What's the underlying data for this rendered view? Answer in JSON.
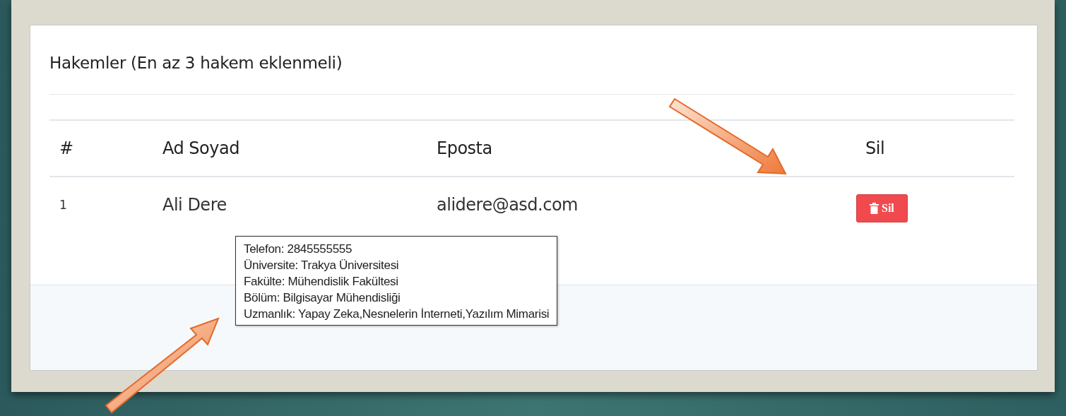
{
  "panel": {
    "title": "Hakemler (En az 3 hakem eklenmeli)"
  },
  "table": {
    "columns": [
      "#",
      "Ad Soyad",
      "Eposta",
      "Sil"
    ],
    "rows": [
      {
        "index": "1",
        "name": "Ali Dere",
        "email": "alidere@asd.com",
        "delete_button": "Sil"
      }
    ]
  },
  "tooltip": {
    "lines": [
      "Telefon: 2845555555",
      "Üniversite: Trakya Üniversitesi",
      "Fakülte: Mühendislik Fakültesi",
      "Bölüm: Bilgisayar Mühendisliği",
      "Uzmanlık: Yapay Zeka,Nesnelerin İnterneti,Yazılım Mimarisi"
    ]
  }
}
